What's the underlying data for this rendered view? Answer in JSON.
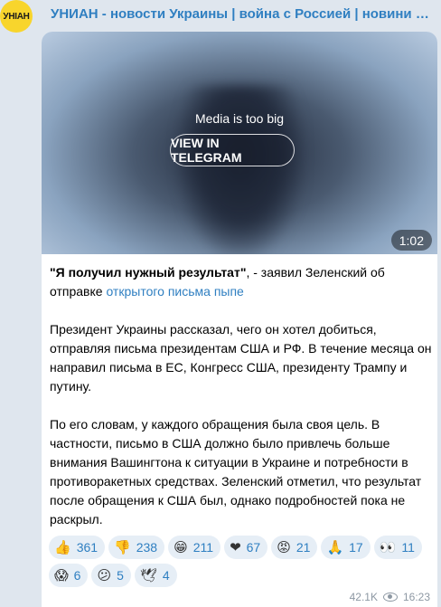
{
  "channel": {
    "avatar_text": "УНIAН",
    "title": "УНИАН - новости Украины | война с Россией | новини Україні…"
  },
  "media": {
    "notice": "Media is too big",
    "button_label": "VIEW IN TELEGRAM",
    "duration": "1:02"
  },
  "message": {
    "quote_bold": "\"Я получил нужный результат\"",
    "quote_rest": ", - заявил Зеленский об отправке ",
    "quote_link": "открытого письма пыпе",
    "para1": "Президент Украины рассказал, чего он хотел добиться, отправляя письма президентам США и РФ. В течение месяца он направил письма в ЕС, Конгресс США, президенту Трампу и путину.",
    "para2": "По его словам, у каждого обращения была своя цель. В частности, письмо в США должно было привлечь больше внимания Вашингтона к ситуации в Украине и потребности в противоракетных средствах. Зеленский отметил, что результат после обращения к США был, однако подробностей пока не раскрыл."
  },
  "reactions": [
    {
      "icon": "thumbs-up",
      "emoji": "👍",
      "count": "361"
    },
    {
      "icon": "thumbs-down",
      "emoji": "👎",
      "count": "238"
    },
    {
      "icon": "grinning-face",
      "emoji": "😁",
      "count": "211"
    },
    {
      "icon": "red-heart",
      "emoji": "❤",
      "count": "67"
    },
    {
      "icon": "angry-face",
      "emoji": "😡",
      "count": "21"
    },
    {
      "icon": "folded-hands",
      "emoji": "🙏",
      "count": "17"
    },
    {
      "icon": "eyes",
      "emoji": "👀",
      "count": "11"
    },
    {
      "icon": "screaming-face",
      "emoji": "😱",
      "count": "6"
    },
    {
      "icon": "confused-face",
      "emoji": "😕",
      "count": "5"
    },
    {
      "icon": "dove",
      "emoji": "🕊",
      "count": "4"
    }
  ],
  "meta": {
    "views": "42.1K",
    "time": "16:23"
  },
  "colors": {
    "accent": "#2f7fc1",
    "background": "#dfe6ee",
    "avatar": "#f8d52c"
  }
}
